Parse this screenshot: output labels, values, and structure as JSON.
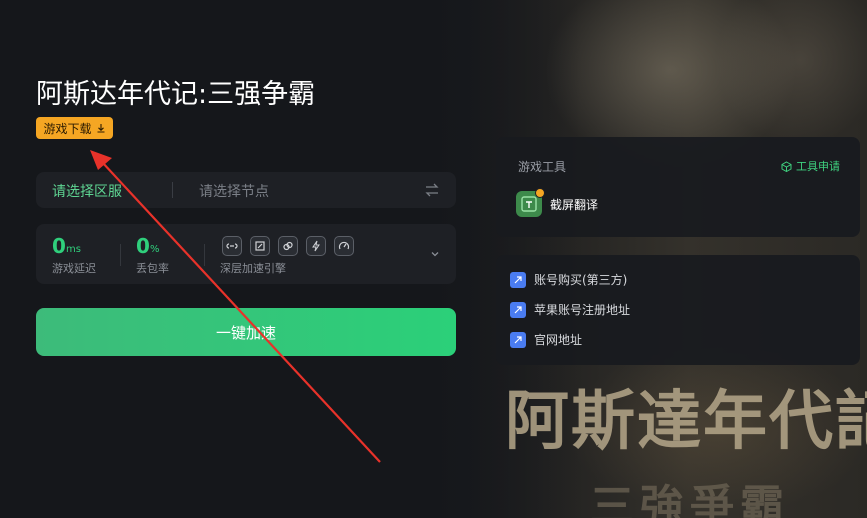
{
  "background": {
    "title_text": "阿斯達年代記",
    "subtitle_text": "三強爭霸"
  },
  "game": {
    "title": "阿斯达年代记:三强争霸",
    "download_label": "游戏下载"
  },
  "server": {
    "region_label": "请选择区服",
    "node_placeholder": "请选择节点",
    "swap_icon": "swap-icon"
  },
  "stats": {
    "latency_value": "0",
    "latency_unit": "ms",
    "latency_label": "游戏延迟",
    "loss_value": "0",
    "loss_unit": "%",
    "loss_label": "丢包率",
    "engine_label": "深层加速引擎",
    "engine_icons": [
      "link-icon",
      "window-icon",
      "circles-icon",
      "bolt-icon",
      "speed-icon"
    ]
  },
  "accelerate_label": "一键加速",
  "tools": {
    "title": "游戏工具",
    "apply_label": "工具申请",
    "items": [
      {
        "label": "截屏翻译",
        "icon": "screenshot-translate-icon"
      }
    ]
  },
  "links": [
    {
      "label": "账号购买(第三方)"
    },
    {
      "label": "苹果账号注册地址"
    },
    {
      "label": "官网地址"
    }
  ],
  "colors": {
    "accent_green": "#2bd079",
    "download_orange": "#f5a623",
    "annotation_red": "#e8322a",
    "link_blue": "#4a7cf0"
  }
}
